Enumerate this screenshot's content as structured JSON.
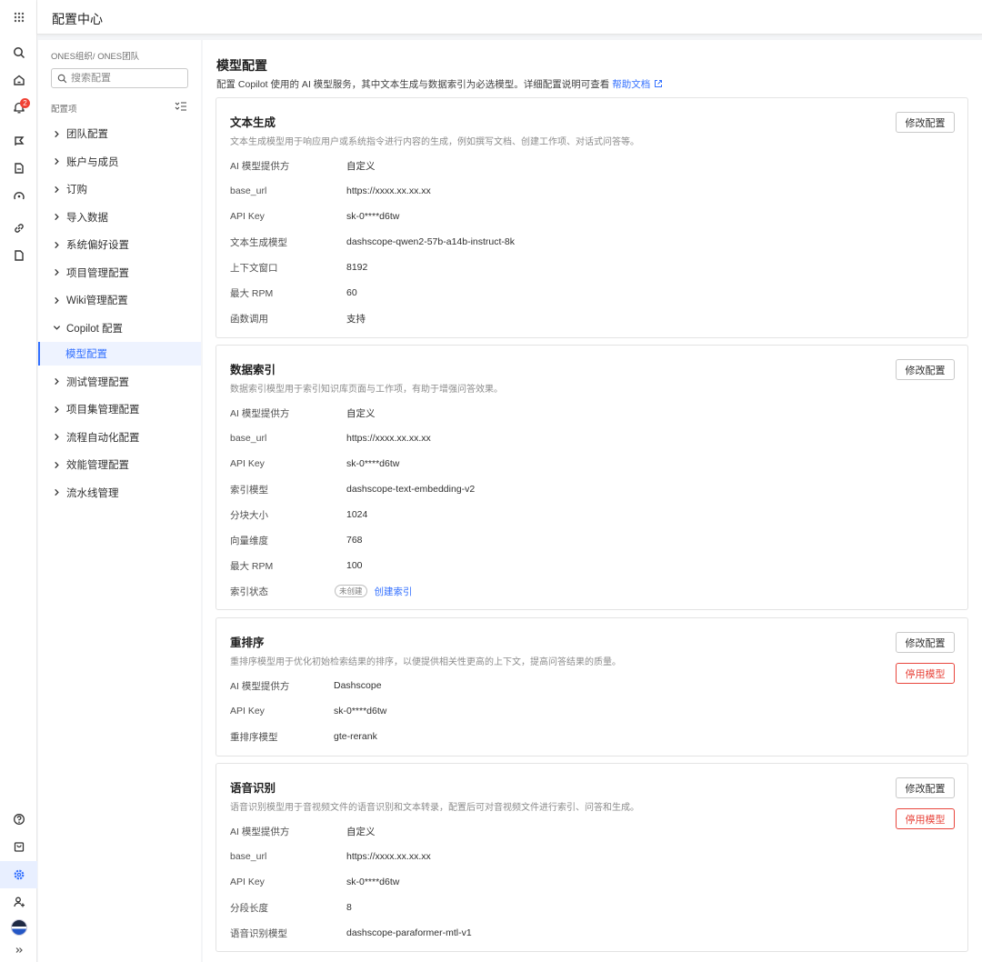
{
  "header": {
    "title": "配置中心"
  },
  "rail": {
    "notification_count": "2"
  },
  "sidebar": {
    "org_path": "ONES组织/ ONES团队",
    "search_placeholder": "搜索配置",
    "section_label": "配置项",
    "items": [
      {
        "label": "团队配置"
      },
      {
        "label": "账户与成员"
      },
      {
        "label": "订购"
      },
      {
        "label": "导入数据"
      },
      {
        "label": "系统偏好设置"
      },
      {
        "label": "项目管理配置"
      },
      {
        "label": "Wiki管理配置"
      },
      {
        "label": "Copilot 配置",
        "sub": "模型配置"
      },
      {
        "label": "测试管理配置"
      },
      {
        "label": "项目集管理配置"
      },
      {
        "label": "流程自动化配置"
      },
      {
        "label": "效能管理配置"
      },
      {
        "label": "流水线管理"
      }
    ]
  },
  "main": {
    "title": "模型配置",
    "desc": "配置 Copilot 使用的 AI 模型服务，其中文本生成与数据索引为必选模型。详细配置说明可查看",
    "help_link": "帮助文档",
    "edit_label": "修改配置",
    "disable_label": "停用模型",
    "cards": [
      {
        "title": "文本生成",
        "desc": "文本生成模型用于响应用户或系统指令进行内容的生成，例如撰写文档、创建工作项、对话式问答等。",
        "rows": [
          {
            "k": "AI 模型提供方",
            "v": "自定义"
          },
          {
            "k": "base_url",
            "v": "https://xxxx.xx.xx.xx"
          },
          {
            "k": "API Key",
            "v": "sk-0****d6tw"
          },
          {
            "k": "文本生成模型",
            "v": "dashscope-qwen2-57b-a14b-instruct-8k"
          },
          {
            "k": "上下文窗口",
            "v": "8192"
          },
          {
            "k": "最大 RPM",
            "v": "60"
          },
          {
            "k": "函数调用",
            "v": "支持"
          }
        ]
      },
      {
        "title": "数据索引",
        "desc": "数据索引模型用于索引知识库页面与工作项，有助于增强问答效果。",
        "rows": [
          {
            "k": "AI 模型提供方",
            "v": "自定义"
          },
          {
            "k": "base_url",
            "v": "https://xxxx.xx.xx.xx"
          },
          {
            "k": "API Key",
            "v": "sk-0****d6tw"
          },
          {
            "k": "索引模型",
            "v": "dashscope-text-embedding-v2"
          },
          {
            "k": "分块大小",
            "v": "1024"
          },
          {
            "k": "向量维度",
            "v": "768"
          },
          {
            "k": "最大 RPM",
            "v": "100"
          },
          {
            "k": "索引状态",
            "tag": "未创建",
            "link": "创建索引"
          }
        ]
      },
      {
        "title": "重排序",
        "desc": "重排序模型用于优化初始检索结果的排序，以便提供相关性更高的上下文，提高问答结果的质量。",
        "rows": [
          {
            "k": "AI 模型提供方",
            "v": "Dashscope"
          },
          {
            "k": "API Key",
            "v": "sk-0****d6tw"
          },
          {
            "k": "重排序模型",
            "v": "gte-rerank"
          }
        ]
      },
      {
        "title": "语音识别",
        "desc": "语音识别模型用于音视频文件的语音识别和文本转录，配置后可对音视频文件进行索引、问答和生成。",
        "rows": [
          {
            "k": "AI 模型提供方",
            "v": "自定义"
          },
          {
            "k": "base_url",
            "v": "https://xxxx.xx.xx.xx"
          },
          {
            "k": "API Key",
            "v": "sk-0****d6tw"
          },
          {
            "k": "分段长度",
            "v": "8"
          },
          {
            "k": "语音识别模型",
            "v": "dashscope-paraformer-mtl-v1"
          }
        ]
      }
    ]
  },
  "colors": {
    "accent": "#3370ff",
    "danger": "#e8453c",
    "badge": "#f04134"
  }
}
